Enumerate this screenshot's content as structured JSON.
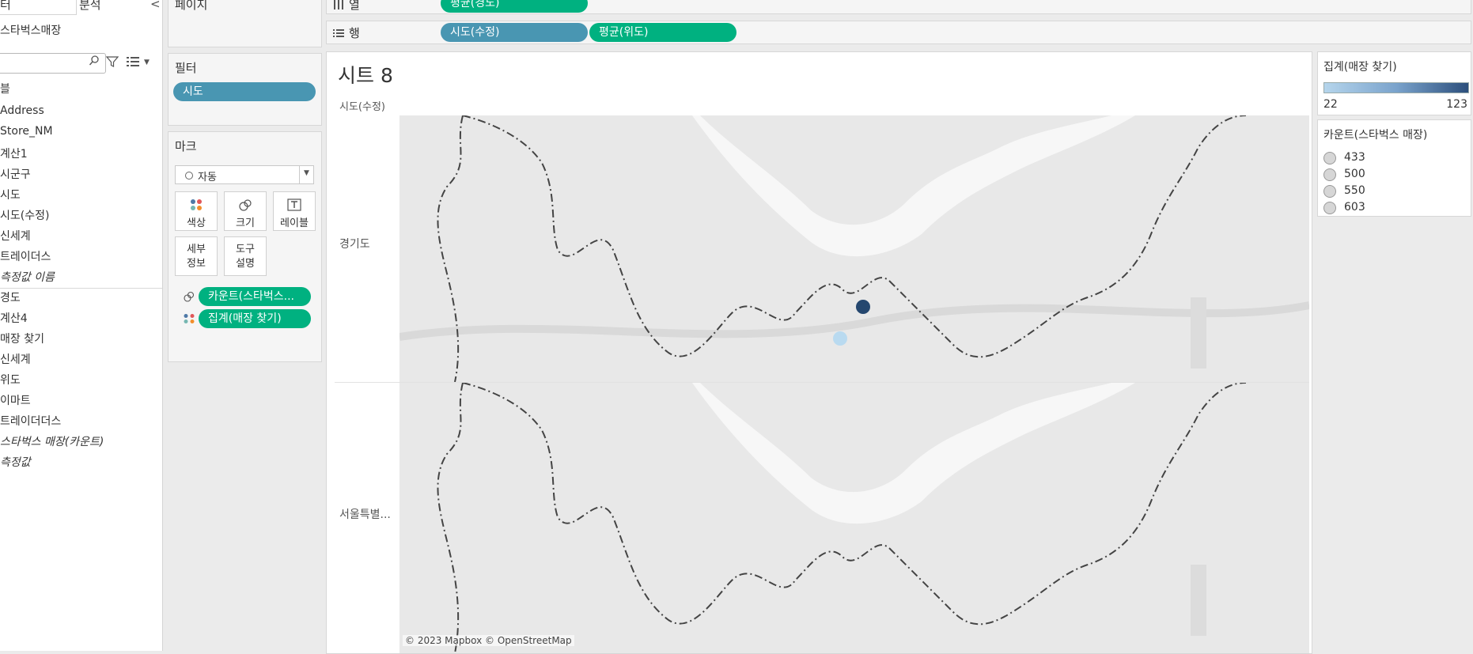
{
  "data_pane": {
    "tab_data": "터",
    "tab_analysis": "분석",
    "collapse_glyph": "<",
    "datasource": "스타벅스매장",
    "search_placeholder": "",
    "dimensions": [
      {
        "label": "블",
        "italic": false,
        "header": true
      },
      {
        "label": "Address",
        "italic": false
      },
      {
        "label": "Store_NM",
        "italic": false
      },
      {
        "label": "계산1",
        "italic": false
      },
      {
        "label": "시군구",
        "italic": false
      },
      {
        "label": "시도",
        "italic": false
      },
      {
        "label": "시도(수정)",
        "italic": false
      },
      {
        "label": "신세계",
        "italic": false
      },
      {
        "label": "트레이더스",
        "italic": false
      },
      {
        "label": "측정값 이름",
        "italic": true
      }
    ],
    "measures": [
      {
        "label": "경도",
        "italic": false
      },
      {
        "label": "계산4",
        "italic": false
      },
      {
        "label": "매장 찾기",
        "italic": false
      },
      {
        "label": "신세계",
        "italic": false
      },
      {
        "label": "위도",
        "italic": false
      },
      {
        "label": "이마트",
        "italic": false
      },
      {
        "label": "트레이더더스",
        "italic": false
      },
      {
        "label": "스타벅스 매장(카운트)",
        "italic": true
      },
      {
        "label": "측정값",
        "italic": true
      }
    ]
  },
  "pages_card": {
    "title": "페이지"
  },
  "filters_card": {
    "title": "필터",
    "pills": [
      "시도"
    ]
  },
  "marks_card": {
    "title": "마크",
    "mark_type": "자동",
    "buttons": {
      "color": "색상",
      "size": "크기",
      "label": "레이블",
      "detail": "세부\n정보",
      "tooltip": "도구\n설명"
    },
    "pills": [
      {
        "label": "카운트(스타벅스...",
        "encoding": "size"
      },
      {
        "label": "집계(매장 찾기)",
        "encoding": "color"
      }
    ]
  },
  "shelves": {
    "columns": {
      "label": "열",
      "pills": [
        "평균(경도)"
      ]
    },
    "rows": {
      "label": "행",
      "pills": [
        "시도(수정)",
        "평균(위도)"
      ]
    }
  },
  "view": {
    "sheet_title": "시트 8",
    "row_header_title": "시도(수정)",
    "rows": [
      "경기도",
      "서울특별..."
    ],
    "attribution": "© 2023 Mapbox © OpenStreetMap"
  },
  "legends": {
    "color": {
      "title": "집계(매장 찾기)",
      "min": "22",
      "max": "123"
    },
    "size": {
      "title": "카운트(스타벅스 매장)",
      "values": [
        "433",
        "500",
        "550",
        "603"
      ]
    }
  },
  "colors": {
    "dimension_pill": "#4996b2",
    "measure_pill": "#00b180",
    "mark_dark": "#25476f",
    "mark_light": "#b9daf0"
  },
  "chart_data": {
    "type": "scatter",
    "panes": [
      "경기도",
      "서울특별..."
    ],
    "points": [
      {
        "pane": "경기도",
        "count": "unknown",
        "color_value": 123
      },
      {
        "pane": "서울특별...",
        "count": "unknown",
        "color_value": 22
      }
    ],
    "color_range": [
      22,
      123
    ],
    "size_legend": [
      433,
      500,
      550,
      603
    ]
  }
}
